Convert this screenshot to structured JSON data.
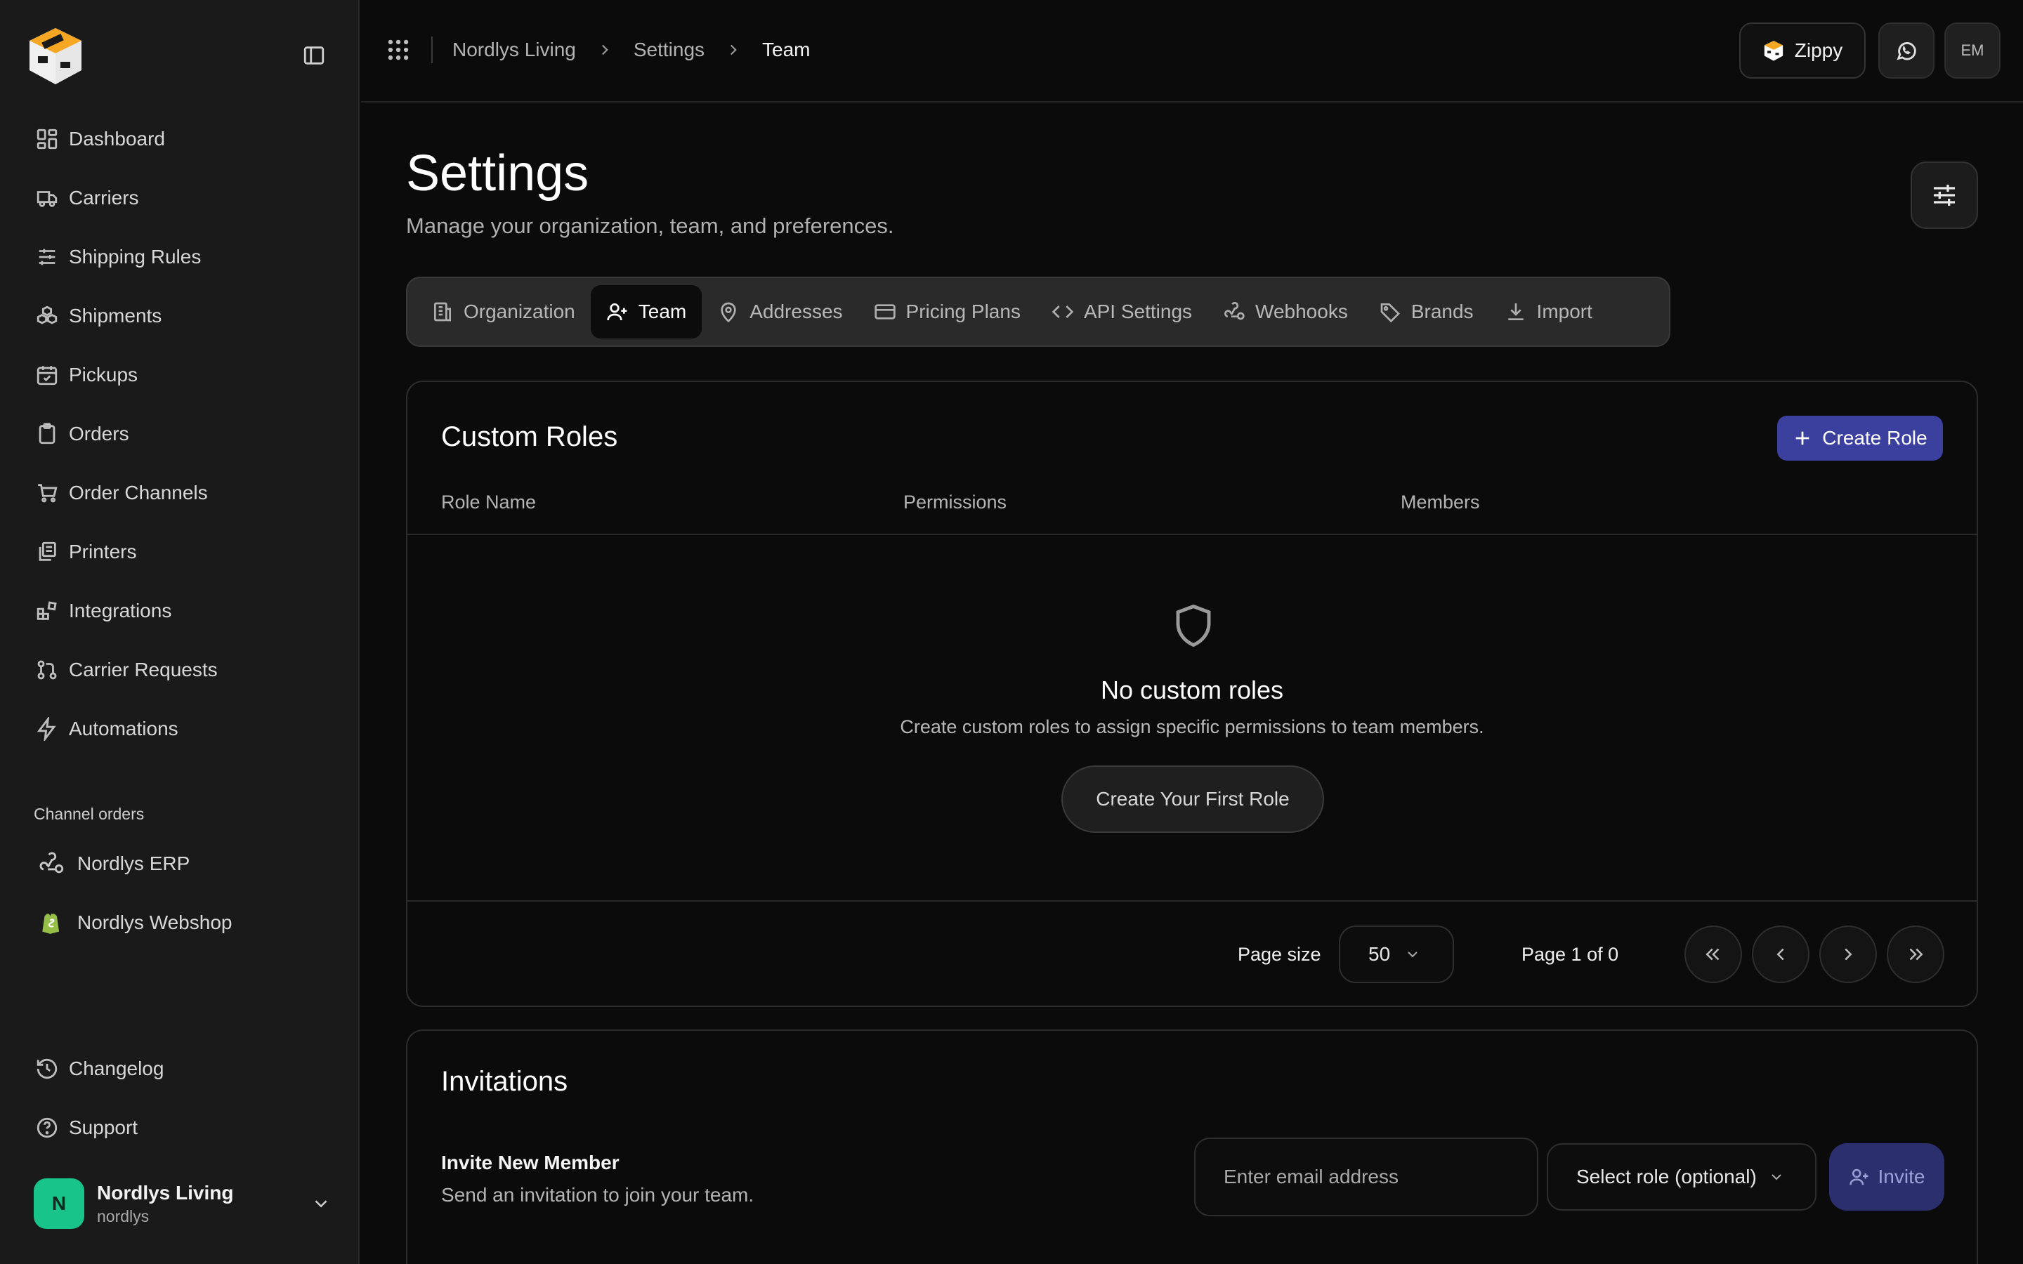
{
  "sidebar": {
    "nav": [
      {
        "label": "Dashboard",
        "icon": "dashboard-icon"
      },
      {
        "label": "Carriers",
        "icon": "truck-icon"
      },
      {
        "label": "Shipping Rules",
        "icon": "sliders-icon"
      },
      {
        "label": "Shipments",
        "icon": "boxes-icon"
      },
      {
        "label": "Pickups",
        "icon": "calendar-check-icon"
      },
      {
        "label": "Orders",
        "icon": "clipboard-icon"
      },
      {
        "label": "Order Channels",
        "icon": "cart-icon"
      },
      {
        "label": "Printers",
        "icon": "printer-icon"
      },
      {
        "label": "Integrations",
        "icon": "blocks-icon"
      },
      {
        "label": "Carrier Requests",
        "icon": "git-pull-request-icon"
      },
      {
        "label": "Automations",
        "icon": "zap-icon"
      }
    ],
    "channels_label": "Channel orders",
    "channels": [
      {
        "label": "Nordlys ERP",
        "icon": "webhook-icon"
      },
      {
        "label": "Nordlys Webshop",
        "icon": "shopify-icon"
      }
    ],
    "bottom": [
      {
        "label": "Changelog",
        "icon": "history-icon"
      },
      {
        "label": "Support",
        "icon": "help-circle-icon"
      }
    ],
    "user": {
      "initial": "N",
      "name": "Nordlys Living",
      "handle": "nordlys"
    }
  },
  "topbar": {
    "breadcrumbs": [
      "Nordlys Living",
      "Settings",
      "Team"
    ],
    "assistant_label": "Zippy",
    "avatar_initials": "EM"
  },
  "page": {
    "title": "Settings",
    "subtitle": "Manage your organization, team, and preferences.",
    "tabs": [
      {
        "label": "Organization",
        "icon": "building-icon"
      },
      {
        "label": "Team",
        "icon": "user-plus-icon",
        "active": true
      },
      {
        "label": "Addresses",
        "icon": "map-pin-icon"
      },
      {
        "label": "Pricing Plans",
        "icon": "credit-card-icon"
      },
      {
        "label": "API Settings",
        "icon": "code-icon"
      },
      {
        "label": "Webhooks",
        "icon": "webhook-icon"
      },
      {
        "label": "Brands",
        "icon": "tag-icon"
      },
      {
        "label": "Import",
        "icon": "download-icon"
      }
    ]
  },
  "roles": {
    "title": "Custom Roles",
    "create_label": "Create Role",
    "columns": [
      "Role Name",
      "Permissions",
      "Members"
    ],
    "empty_title": "No custom roles",
    "empty_text": "Create custom roles to assign specific permissions to team members.",
    "empty_button": "Create Your First Role",
    "pagination": {
      "page_size_label": "Page size",
      "page_size": "50",
      "page_info": "Page 1 of 0"
    }
  },
  "invitations": {
    "title": "Invitations",
    "heading": "Invite New Member",
    "description": "Send an invitation to join your team.",
    "email_placeholder": "Enter email address",
    "role_placeholder": "Select role (optional)",
    "invite_label": "Invite"
  },
  "colors": {
    "accent": "#3b3f9e",
    "accent_disabled": "#2c2f6e",
    "avatar": "#18c48a",
    "logo_orange": "#f5a623"
  }
}
